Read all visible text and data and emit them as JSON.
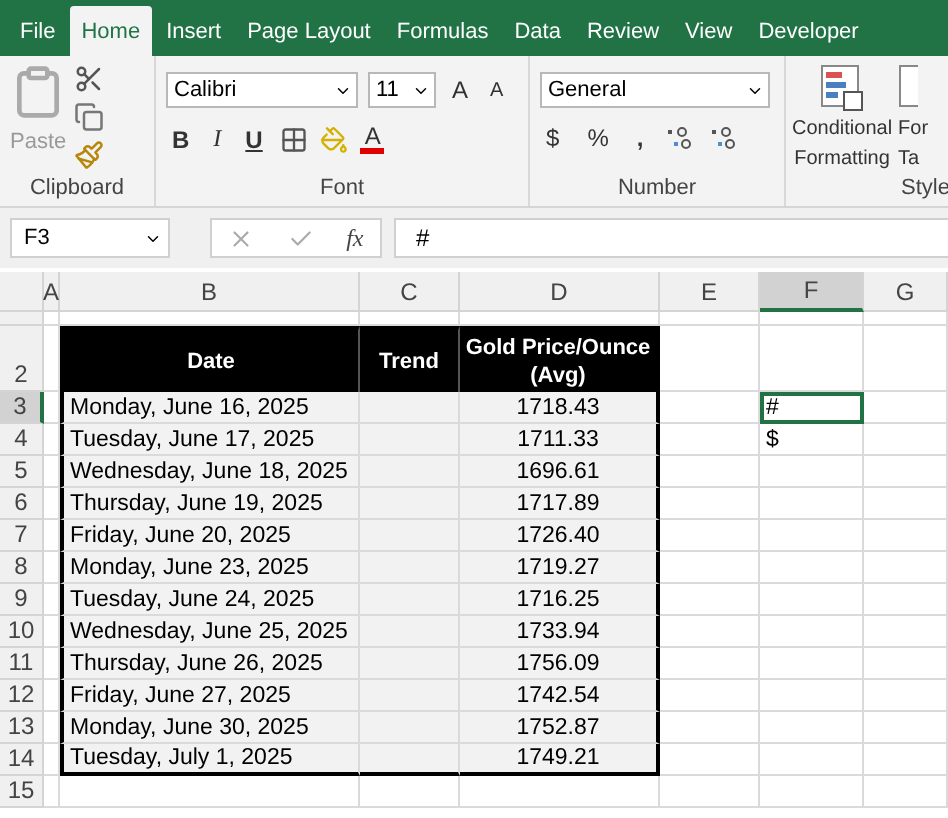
{
  "ribbon_tabs": [
    {
      "label": "File",
      "selected": false
    },
    {
      "label": "Home",
      "selected": true
    },
    {
      "label": "Insert",
      "selected": false
    },
    {
      "label": "Page Layout",
      "selected": false
    },
    {
      "label": "Formulas",
      "selected": false
    },
    {
      "label": "Data",
      "selected": false
    },
    {
      "label": "Review",
      "selected": false
    },
    {
      "label": "View",
      "selected": false
    },
    {
      "label": "Developer",
      "selected": false
    }
  ],
  "ribbon": {
    "clipboard": {
      "paste_label": "Paste",
      "group_label": "Clipboard"
    },
    "font": {
      "name": "Calibri",
      "size": "11",
      "bold": "B",
      "italic": "I",
      "underline": "U",
      "grow": "A",
      "shrink": "A",
      "font_color": "A",
      "group_label": "Font"
    },
    "number": {
      "format": "General",
      "currency": "$",
      "percent": "%",
      "comma": ",",
      "group_label": "Number"
    },
    "styles": {
      "conditional_formatting": [
        "Conditional",
        "Formatting"
      ],
      "format_as_table": [
        "For",
        "Ta"
      ],
      "group_label": "Style"
    }
  },
  "formula_bar": {
    "name_box": "F3",
    "function_label": "fx",
    "formula": "#"
  },
  "sheet": {
    "columns": [
      {
        "label": "A",
        "selected": false
      },
      {
        "label": "B",
        "selected": false
      },
      {
        "label": "C",
        "selected": false
      },
      {
        "label": "D",
        "selected": false
      },
      {
        "label": "E",
        "selected": false
      },
      {
        "label": "F",
        "selected": true
      },
      {
        "label": "G",
        "selected": false
      }
    ],
    "header_row": {
      "row": "2",
      "selected": false,
      "headers": [
        "Date",
        "Trend",
        "Gold Price/Ounce (Avg)"
      ]
    },
    "rows": [
      {
        "row": "3",
        "selected": true,
        "date": "Monday, June 16, 2025",
        "price": "1718.43",
        "column_f": {
          "value": "#",
          "active": true
        }
      },
      {
        "row": "4",
        "selected": false,
        "date": "Tuesday, June 17, 2025",
        "price": "1711.33",
        "column_f": {
          "value": "$",
          "active": false
        }
      },
      {
        "row": "5",
        "selected": false,
        "date": "Wednesday, June 18, 2025",
        "price": "1696.61"
      },
      {
        "row": "6",
        "selected": false,
        "date": "Thursday, June 19, 2025",
        "price": "1717.89"
      },
      {
        "row": "7",
        "selected": false,
        "date": "Friday, June 20, 2025",
        "price": "1726.40"
      },
      {
        "row": "8",
        "selected": false,
        "date": "Monday, June 23, 2025",
        "price": "1719.27"
      },
      {
        "row": "9",
        "selected": false,
        "date": "Tuesday, June 24, 2025",
        "price": "1716.25"
      },
      {
        "row": "10",
        "selected": false,
        "date": "Wednesday, June 25, 2025",
        "price": "1733.94"
      },
      {
        "row": "11",
        "selected": false,
        "date": "Thursday, June 26, 2025",
        "price": "1756.09"
      },
      {
        "row": "12",
        "selected": false,
        "date": "Friday, June 27, 2025",
        "price": "1742.54"
      },
      {
        "row": "13",
        "selected": false,
        "date": "Monday, June 30, 2025",
        "price": "1752.87"
      },
      {
        "row": "14",
        "selected": false,
        "date": "Tuesday, July 1, 2025",
        "price": "1749.21"
      }
    ],
    "trailing_rows": [
      {
        "row": "15",
        "selected": false
      }
    ]
  }
}
